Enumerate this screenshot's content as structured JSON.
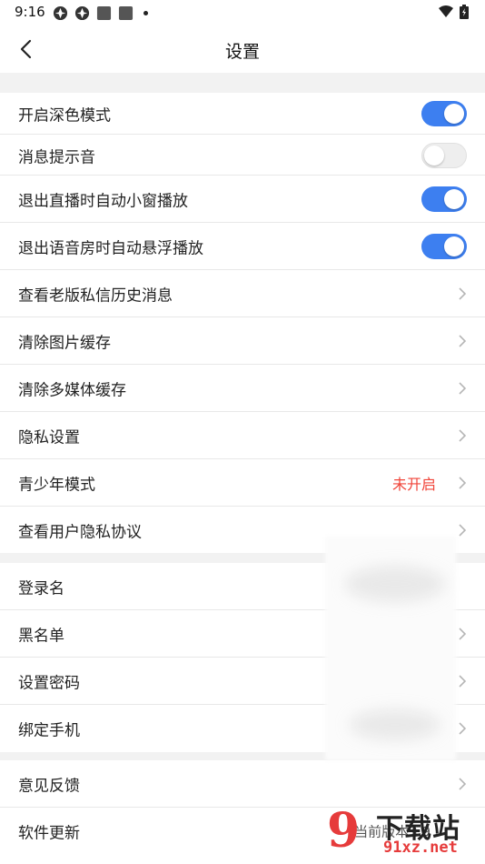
{
  "status_bar": {
    "time": "9:16",
    "icons_left": [
      "app-notification-icon",
      "app-notification-icon",
      "square-notification-icon",
      "square-notification-icon"
    ],
    "icons_right": [
      "wifi-icon",
      "battery-charging-icon"
    ]
  },
  "header": {
    "title": "设置",
    "back_icon": "chevron-left-icon"
  },
  "settings": {
    "group1": [
      {
        "label": "开启深色模式",
        "toggle": true
      },
      {
        "label": "消息提示音",
        "toggle": false
      },
      {
        "label": "退出直播时自动小窗播放",
        "toggle": true
      },
      {
        "label": "退出语音房时自动悬浮播放",
        "toggle": true
      },
      {
        "label": "查看老版私信历史消息"
      },
      {
        "label": "清除图片缓存"
      },
      {
        "label": "清除多媒体缓存"
      },
      {
        "label": "隐私设置"
      },
      {
        "label": "青少年模式",
        "value": "未开启",
        "value_color": "#f0453a"
      },
      {
        "label": "查看用户隐私协议"
      }
    ],
    "group2": [
      {
        "label": "登录名"
      },
      {
        "label": "黑名单"
      },
      {
        "label": "设置密码"
      },
      {
        "label": "绑定手机"
      }
    ],
    "group3": [
      {
        "label": "意见反馈"
      },
      {
        "label": "软件更新",
        "value": "当前版本3.9"
      }
    ]
  },
  "watermark": {
    "logo_text": "9",
    "name": "下载站",
    "domain": "91xz.net"
  },
  "colors": {
    "accent": "#3d7ff0",
    "warning_text": "#f0453a",
    "section_gap": "#f2f2f2"
  }
}
